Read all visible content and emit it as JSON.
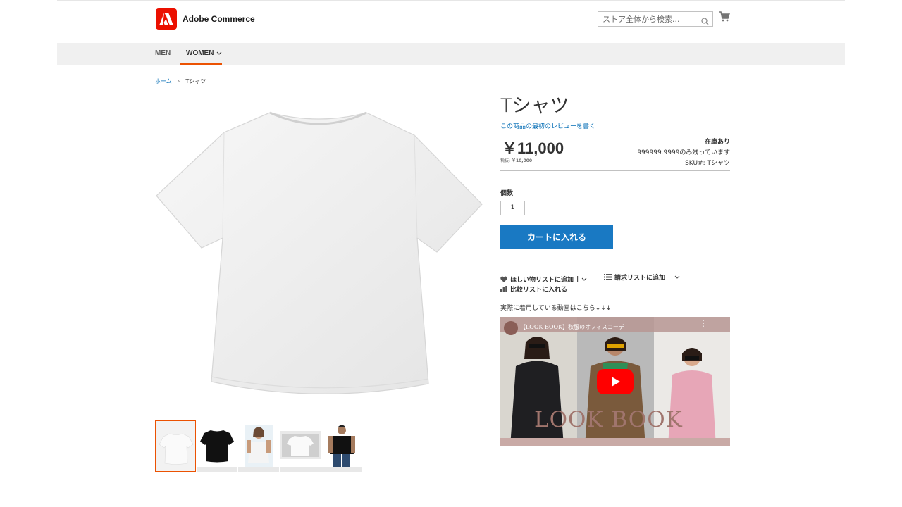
{
  "header": {
    "logo_text": "Adobe Commerce",
    "search_placeholder": "ストア全体から検索...",
    "brand_color": "#eb1000"
  },
  "nav": {
    "items": [
      {
        "label": "MEN"
      },
      {
        "label": "WOMEN"
      }
    ],
    "active_color": "#eb5202"
  },
  "breadcrumb": {
    "home": "ホーム",
    "current": "Tシャツ"
  },
  "product": {
    "title": "Tシャツ",
    "review_link": "この商品の最初のレビューを書く",
    "price": "￥11,000",
    "price_excl_label": "税抜:",
    "price_excl_value": "￥10,000",
    "stock_status": "在庫あり",
    "stock_remaining": "999999.9999のみ残っています",
    "sku_label": "SKU#:",
    "sku_value": "Tシャツ",
    "qty_label": "個数",
    "qty_value": "1",
    "add_to_cart": "カートに入れる",
    "wishlist": "ほしい物リストに追加",
    "wishlist_sep": "|",
    "compare": "比較リストに入れる",
    "requisition": "請求リストに追加",
    "video_note": "実際に着用している動画はこちら↓↓↓",
    "video_title": "【LOOK BOOK】秋服のオフィスコーデ",
    "video_brand": "LOOK BOOK",
    "button_color": "#1979c3"
  },
  "gallery": {
    "thumbnails": [
      {
        "name": "white-tshirt"
      },
      {
        "name": "black-tshirt"
      },
      {
        "name": "model-white-tshirt"
      },
      {
        "name": "white-tshirt-table"
      },
      {
        "name": "model-black-tshirt"
      }
    ]
  }
}
